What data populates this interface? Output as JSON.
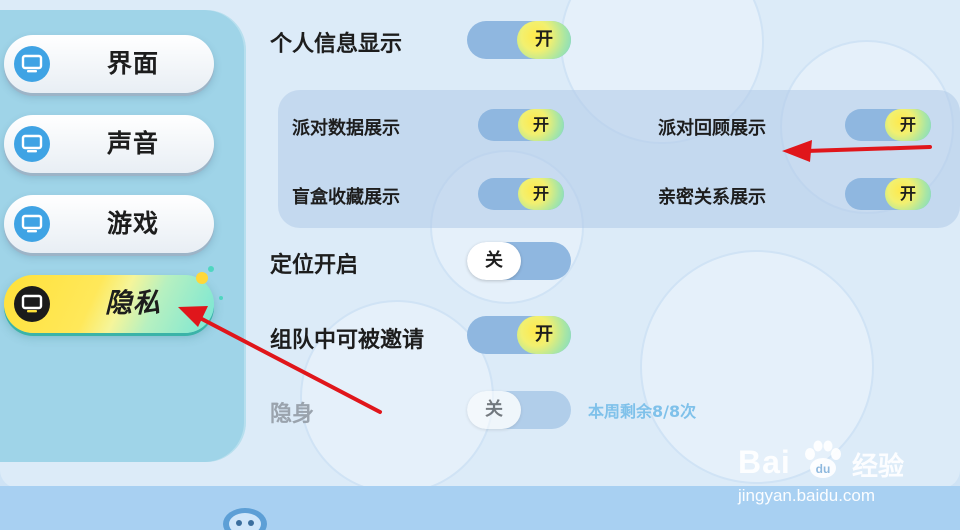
{
  "sidebar": {
    "items": [
      {
        "label": "界面"
      },
      {
        "label": "声音"
      },
      {
        "label": "游戏"
      },
      {
        "label": "隐私"
      }
    ],
    "active_index": 3
  },
  "settings": {
    "personal_info": {
      "label": "个人信息显示",
      "state": "开"
    },
    "party_data": {
      "label": "派对数据展示",
      "state": "开"
    },
    "party_review": {
      "label": "派对回顾展示",
      "state": "开"
    },
    "blindbox": {
      "label": "盲盒收藏展示",
      "state": "开"
    },
    "intimacy": {
      "label": "亲密关系展示",
      "state": "开"
    },
    "location": {
      "label": "定位开启",
      "state": "关"
    },
    "team_invite": {
      "label": "组队中可被邀请",
      "state": "开"
    },
    "invisible": {
      "label": "隐身",
      "state": "关",
      "note": "本周剩余8/8次"
    }
  },
  "watermark": {
    "brand": "Bai",
    "brand_suffix": "du",
    "cn": "经验",
    "url": "jingyan.baidu.com"
  },
  "colors": {
    "annotation_arrow": "#e0161b",
    "toggle_track": "#8fb7e0",
    "sidebar_bg": "#9fd4e8",
    "note_text": "#7fc1ea"
  }
}
